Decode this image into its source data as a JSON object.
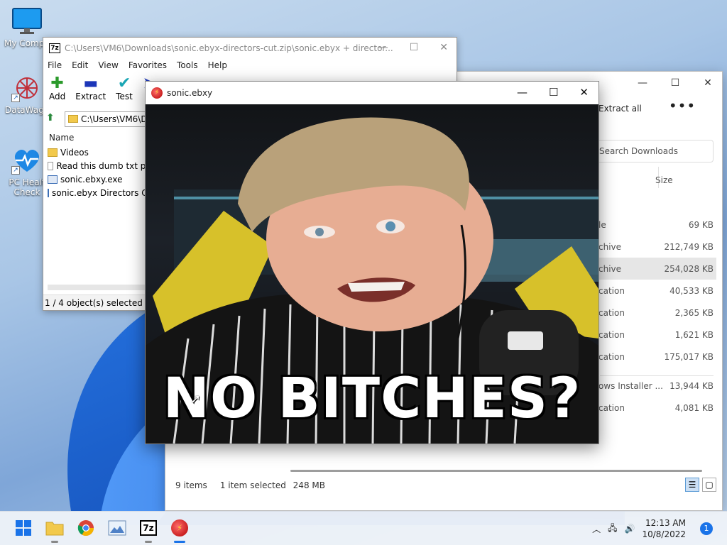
{
  "desktop": {
    "icons": [
      {
        "label": "My Compu"
      },
      {
        "label": "DataWago"
      },
      {
        "label": "PC Healt Check"
      }
    ]
  },
  "explorer": {
    "toolbar": {
      "extract_all": "Extract all",
      "more": "•••"
    },
    "search_placeholder": "Search Downloads",
    "column_size": "Size",
    "rows": [
      {
        "type": "le",
        "size": "69 KB"
      },
      {
        "type": "chive",
        "size": "212,749 KB"
      },
      {
        "type": "chive",
        "size": "254,028 KB"
      },
      {
        "type": "cation",
        "size": "40,533 KB"
      },
      {
        "type": "cation",
        "size": "2,365 KB"
      },
      {
        "type": "cation",
        "size": "1,621 KB"
      },
      {
        "type": "cation",
        "size": "175,017 KB"
      },
      {
        "type": "ows Installer ...",
        "size": "13,944 KB"
      },
      {
        "type": "cation",
        "size": "4,081 KB"
      }
    ],
    "status": {
      "items": "9 items",
      "selected": "1 item selected",
      "size": "248 MB"
    }
  },
  "zip": {
    "title": "C:\\Users\\VM6\\Downloads\\sonic.ebyx-directors-cut.zip\\sonic.ebyx + director...",
    "logo": "7z",
    "menu": [
      "File",
      "Edit",
      "View",
      "Favorites",
      "Tools",
      "Help"
    ],
    "tools": [
      {
        "label": "Add",
        "glyph": "✚"
      },
      {
        "label": "Extract",
        "glyph": "▬"
      },
      {
        "label": "Test",
        "glyph": "✔"
      },
      {
        "label": "C",
        "glyph": "➤"
      }
    ],
    "address": "C:\\Users\\VM6\\D",
    "column_name": "Name",
    "files": [
      {
        "name": "Videos",
        "icon": "folder-icon"
      },
      {
        "name": "Read this dumb txt pls",
        "icon": "text-file-icon"
      },
      {
        "name": "sonic.ebxy.exe",
        "icon": "exe-file-icon"
      },
      {
        "name": "sonic.ebyx Directors Cu",
        "icon": "exe-file-icon"
      }
    ],
    "status": "1 / 4 object(s) selected"
  },
  "viewer": {
    "title": "sonic.ebxy",
    "caption": "NO BITCHES?"
  },
  "taskbar": {
    "time": "12:13 AM",
    "date": "10/8/2022",
    "notification_count": "1",
    "zip_label": "7z"
  },
  "colors": {
    "accent": "#1a73e8",
    "selection": "#e6e6e6",
    "shirt_stripes": "#f2f2f2",
    "chair": "#d7c12a"
  }
}
